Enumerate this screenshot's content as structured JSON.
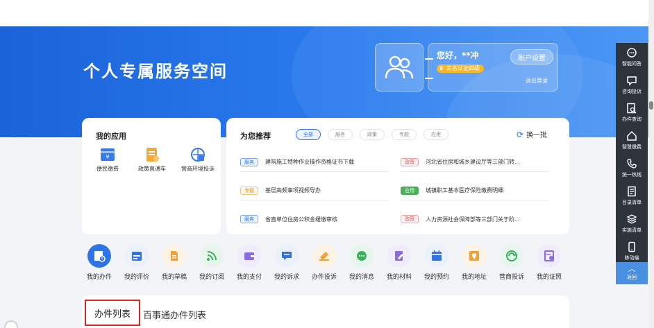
{
  "hero": {
    "title": "个人专属服务空间",
    "greeting": "您好，**冲",
    "badge": "实名认证四级",
    "account_settings": "账户设置",
    "logout": "退出登录"
  },
  "my_apps": {
    "title": "我的应用",
    "items": [
      {
        "label": "便民缴费",
        "icon": "payment-icon"
      },
      {
        "label": "政策直通车",
        "icon": "policy-doc-icon"
      },
      {
        "label": "营商环境投诉",
        "icon": "business-complaint-icon"
      }
    ]
  },
  "recommend": {
    "title": "为您推荐",
    "tabs": [
      "全部",
      "服务",
      "政策",
      "专题",
      "应用"
    ],
    "active_tab": "全部",
    "refresh": "换一批",
    "items": [
      {
        "tag": "服务",
        "type": "svc",
        "text": "建筑施工特种作业操作资格证书下载"
      },
      {
        "tag": "政策",
        "type": "pol",
        "text": "河北省住房和城乡建设厅等三部门转..."
      },
      {
        "tag": "专题",
        "type": "top",
        "text": "基层高频事项视频导办"
      },
      {
        "tag": "应用",
        "type": "app",
        "text": "城镇职工基本医疗保险缴费明细"
      },
      {
        "tag": "服务",
        "type": "svc",
        "text": "省直单位住房公积金缓缴审核"
      },
      {
        "tag": "政策",
        "type": "pol",
        "text": "人力资源社会保障部等三部门关于阶..."
      }
    ]
  },
  "nav": {
    "items": [
      {
        "label": "我的办件",
        "color": "#2f74e6"
      },
      {
        "label": "我的评价",
        "color": "#2f74e6"
      },
      {
        "label": "我的草稿",
        "color": "#f0a23a"
      },
      {
        "label": "我的订阅",
        "color": "#3bb05c"
      },
      {
        "label": "我的支付",
        "color": "#8b6be0"
      },
      {
        "label": "我的诉求",
        "color": "#2f74e6"
      },
      {
        "label": "办件投诉",
        "color": "#f0a23a"
      },
      {
        "label": "我的消息",
        "color": "#3bb05c"
      },
      {
        "label": "我的材料",
        "color": "#8b6be0"
      },
      {
        "label": "我的预约",
        "color": "#2f74e6"
      },
      {
        "label": "我的地址",
        "color": "#f0a23a"
      },
      {
        "label": "营商投诉",
        "color": "#3bb05c"
      },
      {
        "label": "我的证照",
        "color": "#8b6be0"
      }
    ]
  },
  "list": {
    "tab1": "办件列表",
    "tab2": "百事通办件列表"
  },
  "sidebar": {
    "items": [
      {
        "label": "智能问答",
        "icon": "chat-bubble-icon"
      },
      {
        "label": "咨询投诉",
        "icon": "consult-icon"
      },
      {
        "label": "办件查询",
        "icon": "search-doc-icon"
      },
      {
        "label": "智慧缴费",
        "icon": "home-pay-icon"
      },
      {
        "label": "统一热线",
        "icon": "phone-icon"
      },
      {
        "label": "目录清单",
        "icon": "catalog-icon"
      },
      {
        "label": "实施清单",
        "icon": "layers-icon"
      },
      {
        "label": "移动端",
        "icon": "mobile-icon"
      }
    ],
    "back": "返回"
  },
  "colors": {
    "hero_start": "#1a63d8",
    "accent": "#2b6fe8",
    "sidebar_bg": "#2f343c",
    "highlight_border": "#e0241f"
  }
}
